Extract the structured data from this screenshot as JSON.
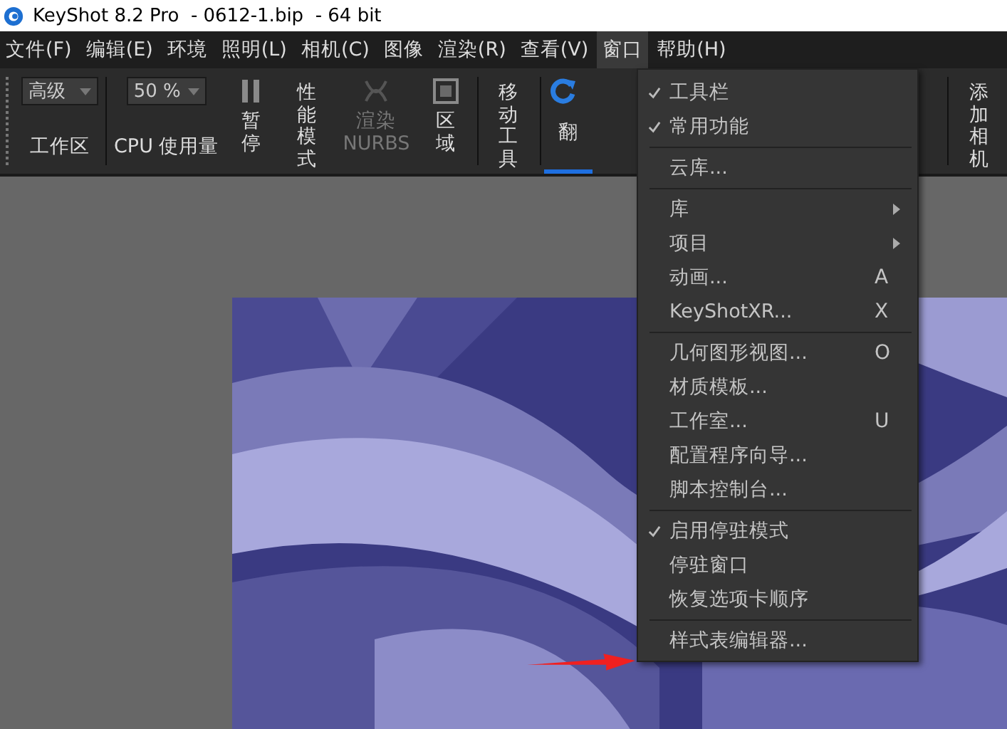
{
  "window": {
    "title": "KeyShot 8.2 Pro  - 0612-1.bip  - 64 bit"
  },
  "menu_bar": [
    {
      "label": "文件(F)",
      "selected": false
    },
    {
      "label": "编辑(E)",
      "selected": false
    },
    {
      "label": "环境",
      "selected": false
    },
    {
      "label": "照明(L)",
      "selected": false
    },
    {
      "label": "相机(C)",
      "selected": false
    },
    {
      "label": "图像",
      "selected": false
    },
    {
      "label": "渲染(R)",
      "selected": false
    },
    {
      "label": "查看(V)",
      "selected": false
    },
    {
      "label": "窗口",
      "selected": true
    },
    {
      "label": "帮助(H)",
      "selected": false
    }
  ],
  "toolbar": {
    "workspace": {
      "value": "高级",
      "label": "工作区"
    },
    "cpu": {
      "value": "50 %",
      "label": "CPU 使用量"
    },
    "tools": [
      {
        "label": "暂停",
        "disabled": false,
        "selected": false
      },
      {
        "label": "性能模式",
        "disabled": false,
        "selected": false
      },
      {
        "label": "渲染 NURBS",
        "disabled": true,
        "selected": false
      },
      {
        "label": "区域",
        "disabled": false,
        "selected": false
      },
      {
        "label": "移动工具",
        "disabled": false,
        "selected": false
      },
      {
        "label": "翻",
        "disabled": false,
        "selected": true
      }
    ],
    "right_tool": {
      "label": "添加相机"
    }
  },
  "window_menu": [
    {
      "kind": "item",
      "label": "工具栏",
      "checked": true
    },
    {
      "kind": "item",
      "label": "常用功能",
      "checked": true
    },
    {
      "kind": "separator"
    },
    {
      "kind": "item",
      "label": "云库...",
      "checked": false
    },
    {
      "kind": "separator"
    },
    {
      "kind": "item",
      "label": "库",
      "checked": false,
      "submenu": true
    },
    {
      "kind": "item",
      "label": "项目",
      "checked": false,
      "submenu": true
    },
    {
      "kind": "item",
      "label": "动画...",
      "checked": false,
      "shortcut": "A"
    },
    {
      "kind": "item",
      "label": "KeyShotXR...",
      "checked": false,
      "shortcut": "X"
    },
    {
      "kind": "separator"
    },
    {
      "kind": "item",
      "label": "几何图形视图...",
      "checked": false,
      "shortcut": "O"
    },
    {
      "kind": "item",
      "label": "材质模板...",
      "checked": false
    },
    {
      "kind": "item",
      "label": "工作室...",
      "checked": false,
      "shortcut": "U"
    },
    {
      "kind": "item",
      "label": "配置程序向导...",
      "checked": false
    },
    {
      "kind": "item",
      "label": "脚本控制台...",
      "checked": false
    },
    {
      "kind": "separator"
    },
    {
      "kind": "item",
      "label": "启用停驻模式",
      "checked": true
    },
    {
      "kind": "item",
      "label": "停驻窗口",
      "checked": false
    },
    {
      "kind": "item",
      "label": "恢复选项卡顺序",
      "checked": false
    },
    {
      "kind": "separator"
    },
    {
      "kind": "item",
      "label": "样式表编辑器...",
      "checked": false
    }
  ]
}
